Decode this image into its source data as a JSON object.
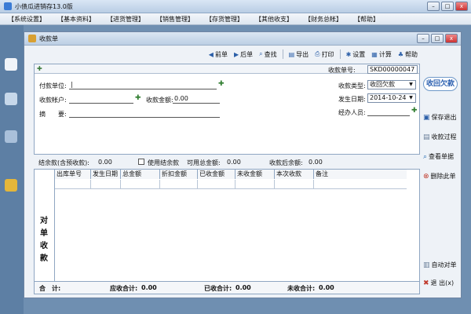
{
  "app": {
    "title": "小债瓜进销存13.0版"
  },
  "window_controls": {
    "minimize": "–",
    "maximize": "□",
    "close": "x"
  },
  "menu": [
    "【系统设置】",
    "【基本资料】",
    "【进货管理】",
    "【销售管理】",
    "【存货管理】",
    "【其他收支】",
    "【财务总帐】",
    "【帮助】"
  ],
  "child": {
    "title": "收款单"
  },
  "toolbar": {
    "prev": "前单",
    "next": "后单",
    "find": "查找",
    "export": "导出",
    "print": "打印",
    "settings": "设置",
    "calc": "计算",
    "help": "帮助"
  },
  "form": {
    "receipt_no_label": "收款单号:",
    "receipt_no": "SKD00000047",
    "payer_label": "付款单位:",
    "payer_value": "|",
    "type_label": "收款类型:",
    "type_value": "收回欠款",
    "account_label": "收款帐户:",
    "account_value": "",
    "amount_label": "收款金额:",
    "amount_value": "0.00",
    "date_label": "发生日期:",
    "date_value": "2014-10-24",
    "memo_label": "摘　　要:",
    "memo_value": "",
    "handler_label": "经办人员:",
    "handler_value": ""
  },
  "summary": {
    "balance_label": "结余款(含预收款):",
    "balance_value": "0.00",
    "use_balance_label": "使用结余款",
    "usable_label": "可用总金额:",
    "usable_value": "0.00",
    "after_label": "收款后余额:",
    "after_value": "0.00"
  },
  "grid": {
    "side_chars": [
      "对",
      "单",
      "收",
      "款"
    ],
    "columns": [
      "出库单号",
      "发生日期",
      "总金额",
      "折扣金额",
      "已收金额",
      "未收金额",
      "本次收款",
      "备注"
    ],
    "footer": {
      "total_label": "合　计:",
      "receivable_label": "应收合计:",
      "receivable_value": "0.00",
      "received_label": "已收合计:",
      "received_value": "0.00",
      "outstanding_label": "未收合计:",
      "outstanding_value": "0.00"
    }
  },
  "right_panel": {
    "title": "收回欠款",
    "save_exit": "保存退出",
    "process": "收款过程",
    "view_doc": "查看单据",
    "delete": "删除此单",
    "auto_reconcile": "自动对单",
    "exit": "退 出(x)"
  }
}
